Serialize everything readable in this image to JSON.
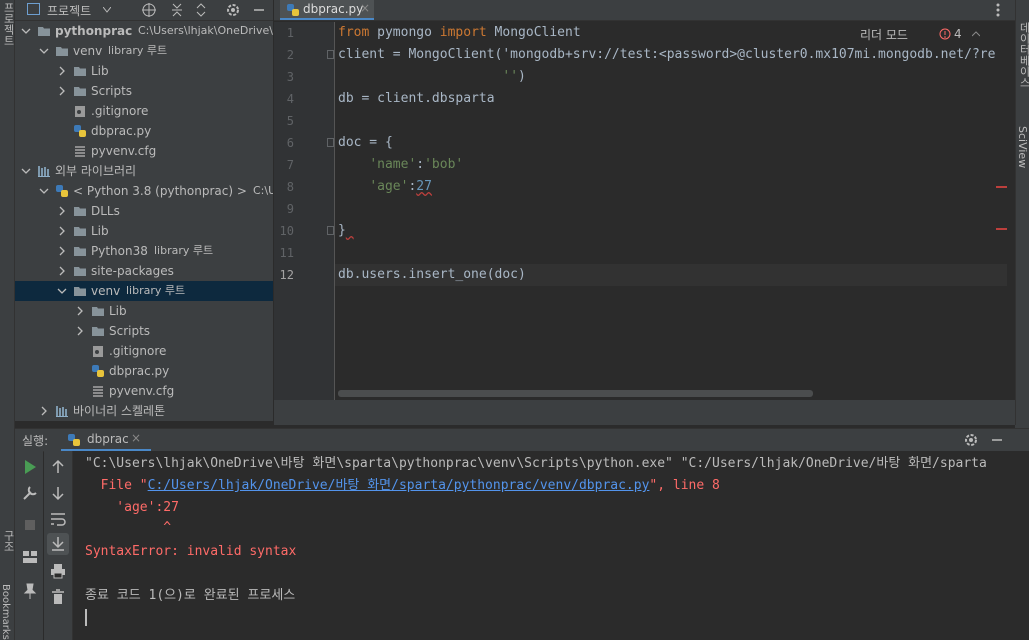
{
  "left_strip": {
    "project_label": "프로젝트",
    "structure_label": "구조",
    "bookmarks_label": "Bookmarks"
  },
  "right_strip": {
    "database_label": "데이터베이스",
    "sciview_label": "SciView"
  },
  "project_panel": {
    "title": "프로젝트",
    "tree": [
      {
        "label": "pythonprac",
        "hint": "C:\\Users\\lhjak\\OneDrive\\바탕",
        "type": "folder",
        "bold": true
      },
      {
        "label": "venv",
        "hint": "library 루트",
        "type": "folder"
      },
      {
        "label": "Lib",
        "hint": "",
        "type": "folder"
      },
      {
        "label": "Scripts",
        "hint": "",
        "type": "folder"
      },
      {
        "label": ".gitignore",
        "hint": "",
        "type": "gitignore"
      },
      {
        "label": "dbprac.py",
        "hint": "",
        "type": "python"
      },
      {
        "label": "pyvenv.cfg",
        "hint": "",
        "type": "cfg"
      },
      {
        "label": "외부 라이브러리",
        "hint": "",
        "type": "library"
      },
      {
        "label": "< Python 3.8 (pythonprac) >",
        "hint": "C:\\Use",
        "type": "python"
      },
      {
        "label": "DLLs",
        "hint": "",
        "type": "folder"
      },
      {
        "label": "Lib",
        "hint": "",
        "type": "folder"
      },
      {
        "label": "Python38",
        "hint": "library 루트",
        "type": "folder"
      },
      {
        "label": "site-packages",
        "hint": "",
        "type": "folder"
      },
      {
        "label": "venv",
        "hint": "library 루트",
        "type": "folder",
        "selected": true
      },
      {
        "label": "Lib",
        "hint": "",
        "type": "folder"
      },
      {
        "label": "Scripts",
        "hint": "",
        "type": "folder"
      },
      {
        "label": ".gitignore",
        "hint": "",
        "type": "gitignore"
      },
      {
        "label": "dbprac.py",
        "hint": "",
        "type": "python"
      },
      {
        "label": "pyvenv.cfg",
        "hint": "",
        "type": "cfg"
      },
      {
        "label": "바이너리 스켈레톤",
        "hint": "",
        "type": "library"
      }
    ]
  },
  "editor": {
    "tab_label": "dbprac.py",
    "reader_mode": "리더 모드",
    "problem_count": "4",
    "line_numbers": [
      "1",
      "2",
      "3",
      "4",
      "5",
      "6",
      "7",
      "8",
      "9",
      "10",
      "11",
      "12"
    ],
    "lines": [
      "from pymongo import MongoClient",
      "client = MongoClient('mongodb+srv://test:<password>@cluster0.mx107mi.mongodb.net/?re",
      "                     '')",
      "db = client.dbsparta",
      "",
      "doc = {",
      "    'name':'bob'",
      "    'age':27",
      "",
      "}",
      "",
      "db.users.insert_one(doc)"
    ]
  },
  "run_panel": {
    "run_label": "실행:",
    "tab_label": "dbprac",
    "console": {
      "cmd": "\"C:\\Users\\lhjak\\OneDrive\\바탕 화면\\sparta\\pythonprac\\venv\\Scripts\\python.exe\" \"C:/Users/lhjak/OneDrive/바탕 화면/sparta",
      "file_prefix": "  File \"",
      "file_link": "C:/Users/lhjak/OneDrive/바탕 화면/sparta/pythonprac/venv/dbprac.py",
      "file_suffix": "\", line 8",
      "err_code": "    'age':27",
      "caret": "          ^",
      "error": "SyntaxError: invalid syntax",
      "exit": "종료 코드 1(으)로 완료된 프로세스"
    }
  },
  "colors": {
    "selection": "#0d293e",
    "accent": "#4a88c7",
    "error": "#ff6b68",
    "keyword": "#cc7832",
    "string": "#6a8759",
    "number": "#6897bb"
  }
}
